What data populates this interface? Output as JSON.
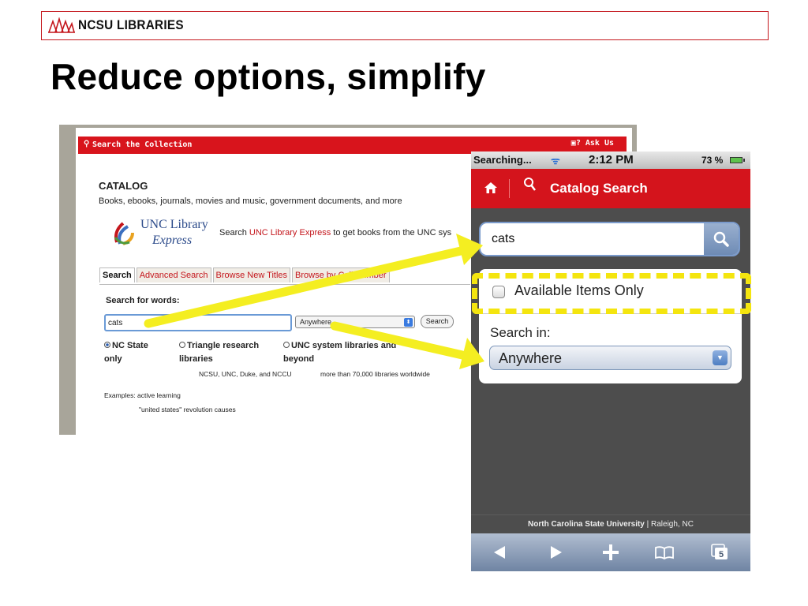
{
  "slide": {
    "brand": "NCSU LIBRARIES",
    "title": "Reduce options, simplify"
  },
  "desktop": {
    "bar_left": "Search the Collection",
    "bar_right": "? Ask Us",
    "catalog_heading": "CATALOG",
    "catalog_desc": "Books, ebooks, journals, movies and music, government documents, and more",
    "unc_logo_line1": "UNC Library",
    "unc_logo_line2": "Express",
    "unc_text_before": "Search ",
    "unc_text_link": "UNC Library Express",
    "unc_text_after": " to get books from the UNC sys",
    "tabs": [
      "Search",
      "Advanced Search",
      "Browse New Titles",
      "Browse by Call Number"
    ],
    "search_for_words": "Search for words:",
    "search_value": "cats",
    "select_value": "Anywhere",
    "search_button": "Search",
    "options": [
      {
        "line1": "NC State",
        "line2": "only",
        "sub": ""
      },
      {
        "line1": "Triangle research",
        "line2": "libraries",
        "sub": "NCSU, UNC, Duke, and NCCU"
      },
      {
        "line1": "UNC system libraries and",
        "line2": "beyond",
        "sub": "more than 70,000 libraries worldwide"
      }
    ],
    "examples_label": "Examples: active learning",
    "examples_2": "\"united states\" revolution causes"
  },
  "phone": {
    "status_left": "Searching...",
    "status_time": "2:12 PM",
    "status_battery": "73 %",
    "nav_title": "Catalog Search",
    "search_value": "cats",
    "checkbox_label": "Available Items Only",
    "search_in_label": "Search in:",
    "select_value": "Anywhere",
    "footer_bold": "North Carolina State University",
    "footer_rest": " | Raleigh, NC",
    "tabs_count": "5"
  },
  "colors": {
    "brand_red": "#d4141c",
    "highlight_yellow": "#f4e50f"
  },
  "icons": [
    "ncsu-logo-icon",
    "search-icon",
    "ask-us-icon",
    "unc-logo-icon",
    "wifi-icon",
    "battery-icon",
    "home-icon",
    "magnifier-icon",
    "checkbox-icon",
    "dropdown-arrow-icon",
    "back-icon",
    "forward-icon",
    "add-icon",
    "bookmarks-icon",
    "tabs-icon"
  ]
}
